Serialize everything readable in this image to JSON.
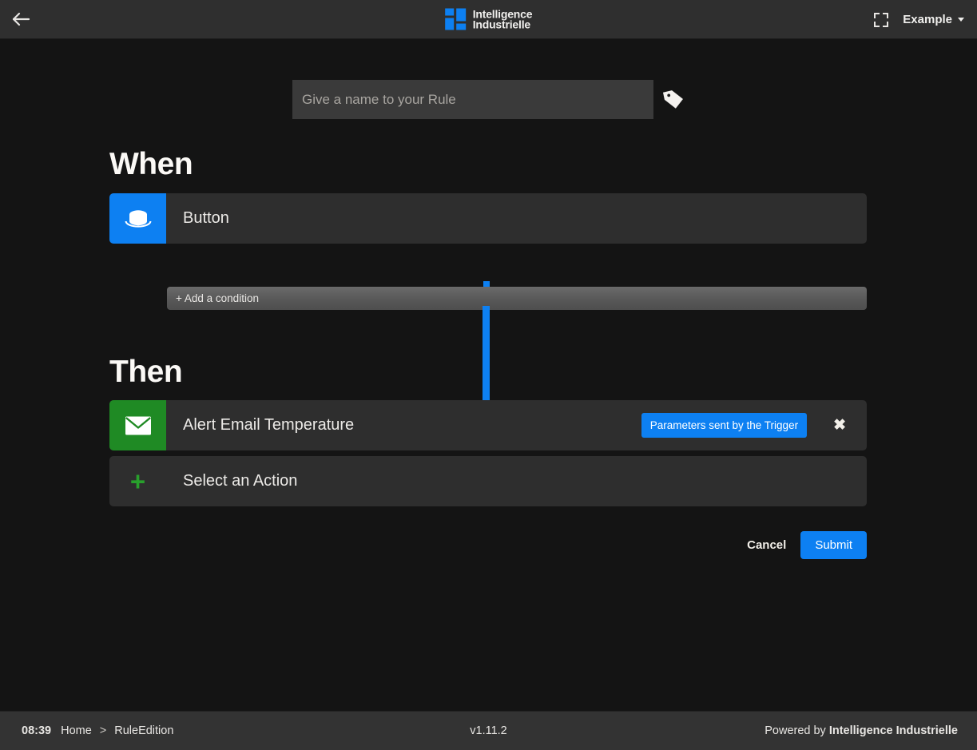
{
  "topbar": {
    "back_icon": "arrow-left-icon",
    "brand": {
      "line1": "Intelligence",
      "line2": "Industrielle",
      "mark_color": "#0d80f2"
    },
    "fullscreen_icon": "fullscreen-icon",
    "user_label": "Example",
    "caret_icon": "chevron-down-icon"
  },
  "rule": {
    "name_value": "",
    "name_placeholder": "Give a name to your Rule",
    "tag_icon": "tag-icon"
  },
  "when": {
    "title": "When",
    "trigger": {
      "icon": "push-button-icon",
      "icon_color": "#0d80f2",
      "label": "Button"
    },
    "add_condition_label": "+ Add a condition"
  },
  "then": {
    "title": "Then",
    "actions": [
      {
        "icon": "envelope-icon",
        "icon_color": "#1f8a24",
        "label": "Alert Email Temperature",
        "badge": "Parameters sent by the Trigger",
        "badge_color": "#0d80f2",
        "close_icon": "close-icon",
        "close_glyph": "✖"
      }
    ],
    "select_action": {
      "icon": "plus-icon",
      "icon_color": "#28a02c",
      "glyph": "+",
      "label": "Select an Action"
    }
  },
  "form_actions": {
    "cancel_label": "Cancel",
    "submit_label": "Submit",
    "submit_color": "#0d80f2"
  },
  "statusbar": {
    "time": "08:39",
    "crumb_home": "Home",
    "crumb_separator": ">",
    "crumb_current": "RuleEdition",
    "version": "v1.11.2",
    "powered_prefix": "Powered by ",
    "powered_brand": "Intelligence Industrielle"
  }
}
